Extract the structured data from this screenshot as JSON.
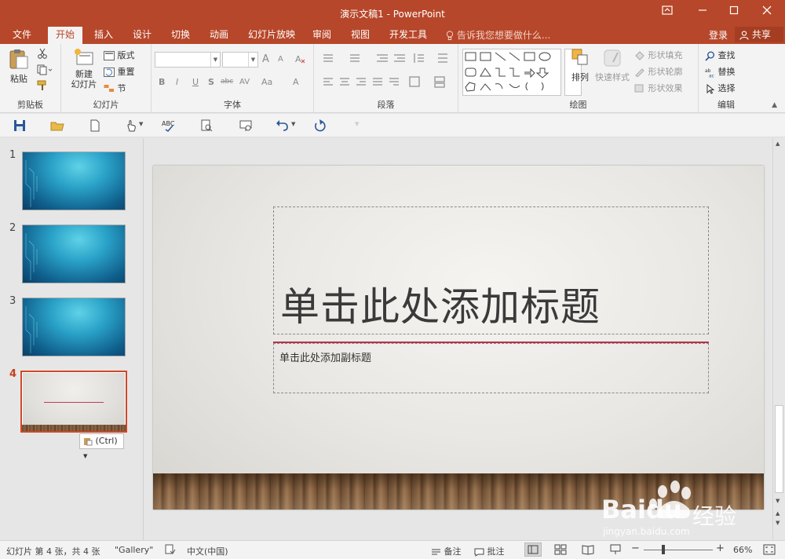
{
  "window": {
    "title": "演示文稿1 - PowerPoint"
  },
  "tabs": [
    {
      "label": "文件"
    },
    {
      "label": "开始"
    },
    {
      "label": "插入"
    },
    {
      "label": "设计"
    },
    {
      "label": "切换"
    },
    {
      "label": "动画"
    },
    {
      "label": "幻灯片放映"
    },
    {
      "label": "审阅"
    },
    {
      "label": "视图"
    },
    {
      "label": "开发工具"
    }
  ],
  "tell_me": "告诉我您想要做什么...",
  "account": {
    "login": "登录",
    "share": "共享"
  },
  "ribbon": {
    "clipboard": {
      "paste": "粘贴",
      "group": "剪贴板"
    },
    "slides": {
      "new_slide_1": "新建",
      "new_slide_2": "幻灯片",
      "layout": "版式",
      "reset": "重置",
      "section": "节",
      "group": "幻灯片"
    },
    "font": {
      "grow": "A",
      "shrink": "A",
      "bold": "B",
      "italic": "I",
      "underline": "U",
      "shadow": "S",
      "strike": "abc",
      "spacing": "AV",
      "case": "Aa",
      "color": "A",
      "group": "字体"
    },
    "paragraph": {
      "group": "段落"
    },
    "drawing": {
      "arrange": "排列",
      "quick_styles": "快速样式",
      "fill": "形状填充",
      "outline": "形状轮廓",
      "effects": "形状效果",
      "group": "绘图"
    },
    "editing": {
      "find": "查找",
      "replace": "替换",
      "select": "选择",
      "group": "编辑"
    }
  },
  "thumbnails": [
    {
      "number": "1"
    },
    {
      "number": "2"
    },
    {
      "number": "3"
    },
    {
      "number": "4"
    }
  ],
  "paste_options": "(Ctrl)",
  "slide": {
    "title_placeholder": "单击此处添加标题",
    "subtitle_placeholder": "单击此处添加副标题"
  },
  "status": {
    "slide_info": "幻灯片 第 4 张，共 4 张",
    "theme": "\"Gallery\"",
    "language": "中文(中国)",
    "notes": "备注",
    "comments": "批注",
    "zoom": "66%"
  },
  "watermark": {
    "brand": "Baidu",
    "brand2": "经验",
    "url": "jingyan.baidu.com"
  },
  "colors": {
    "accent": "#b7472a",
    "active_tab_text": "#b7472a",
    "selected_border": "#d24726",
    "title_rule": "#b8324a"
  }
}
